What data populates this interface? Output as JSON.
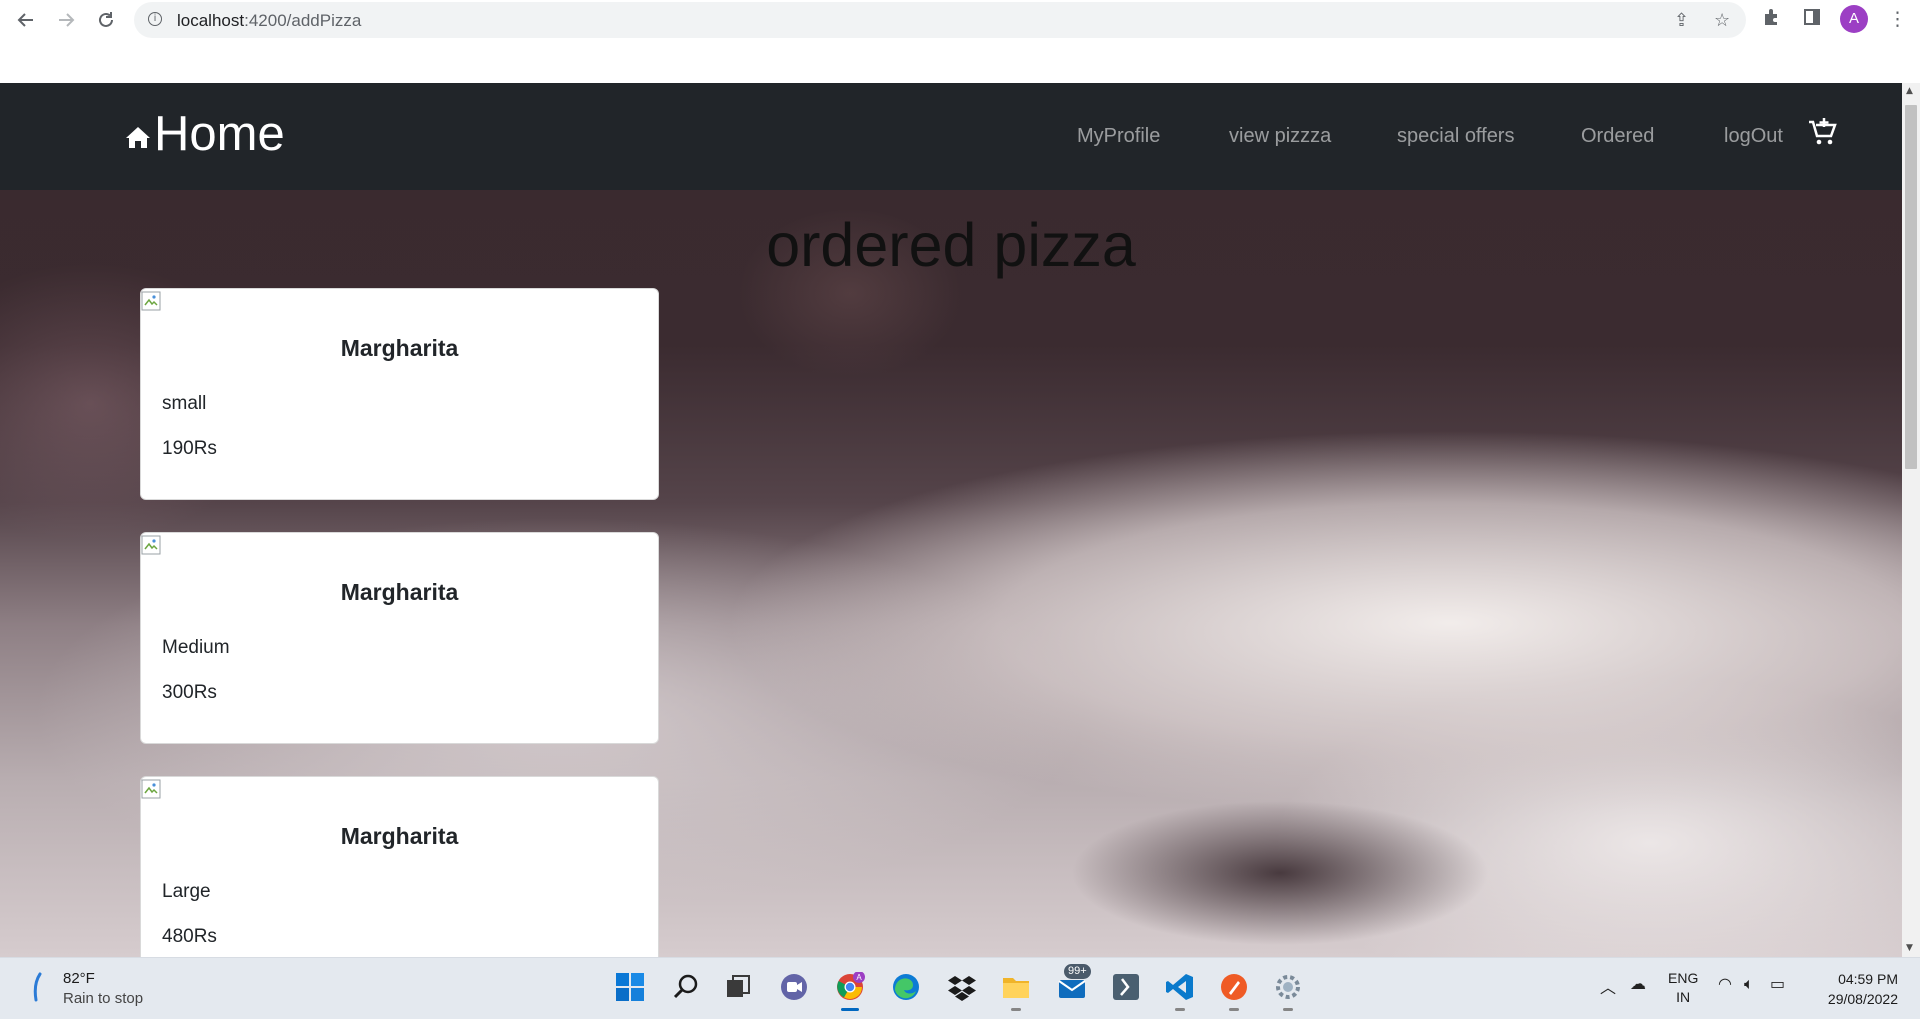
{
  "browser": {
    "url_host": "localhost",
    "url_path": ":4200/addPizza",
    "profile_initial": "A"
  },
  "navbar": {
    "brand": "Home",
    "links": [
      "MyProfile",
      "view pizzza",
      "special offers",
      "Ordered",
      "logOut"
    ]
  },
  "page": {
    "title": "ordered pizza"
  },
  "orders": [
    {
      "name": "Margharita",
      "size": "small",
      "price": "190Rs"
    },
    {
      "name": "Margharita",
      "size": "Medium",
      "price": "300Rs"
    },
    {
      "name": "Margharita",
      "size": "Large",
      "price": "480Rs"
    }
  ],
  "taskbar": {
    "weather_temp": "82°F",
    "weather_desc": "Rain to stop",
    "mail_badge": "99+",
    "lang_line1": "ENG",
    "lang_line2": "IN",
    "time": "04:59 PM",
    "date": "29/08/2022",
    "apps": [
      "start-icon",
      "search-icon",
      "task-view-icon",
      "teams-chat-icon",
      "chrome-icon",
      "edge-icon",
      "dropbox-icon",
      "file-explorer-icon",
      "mail-icon",
      "powershell-icon",
      "vscode-icon",
      "postman-icon",
      "settings-icon"
    ]
  }
}
